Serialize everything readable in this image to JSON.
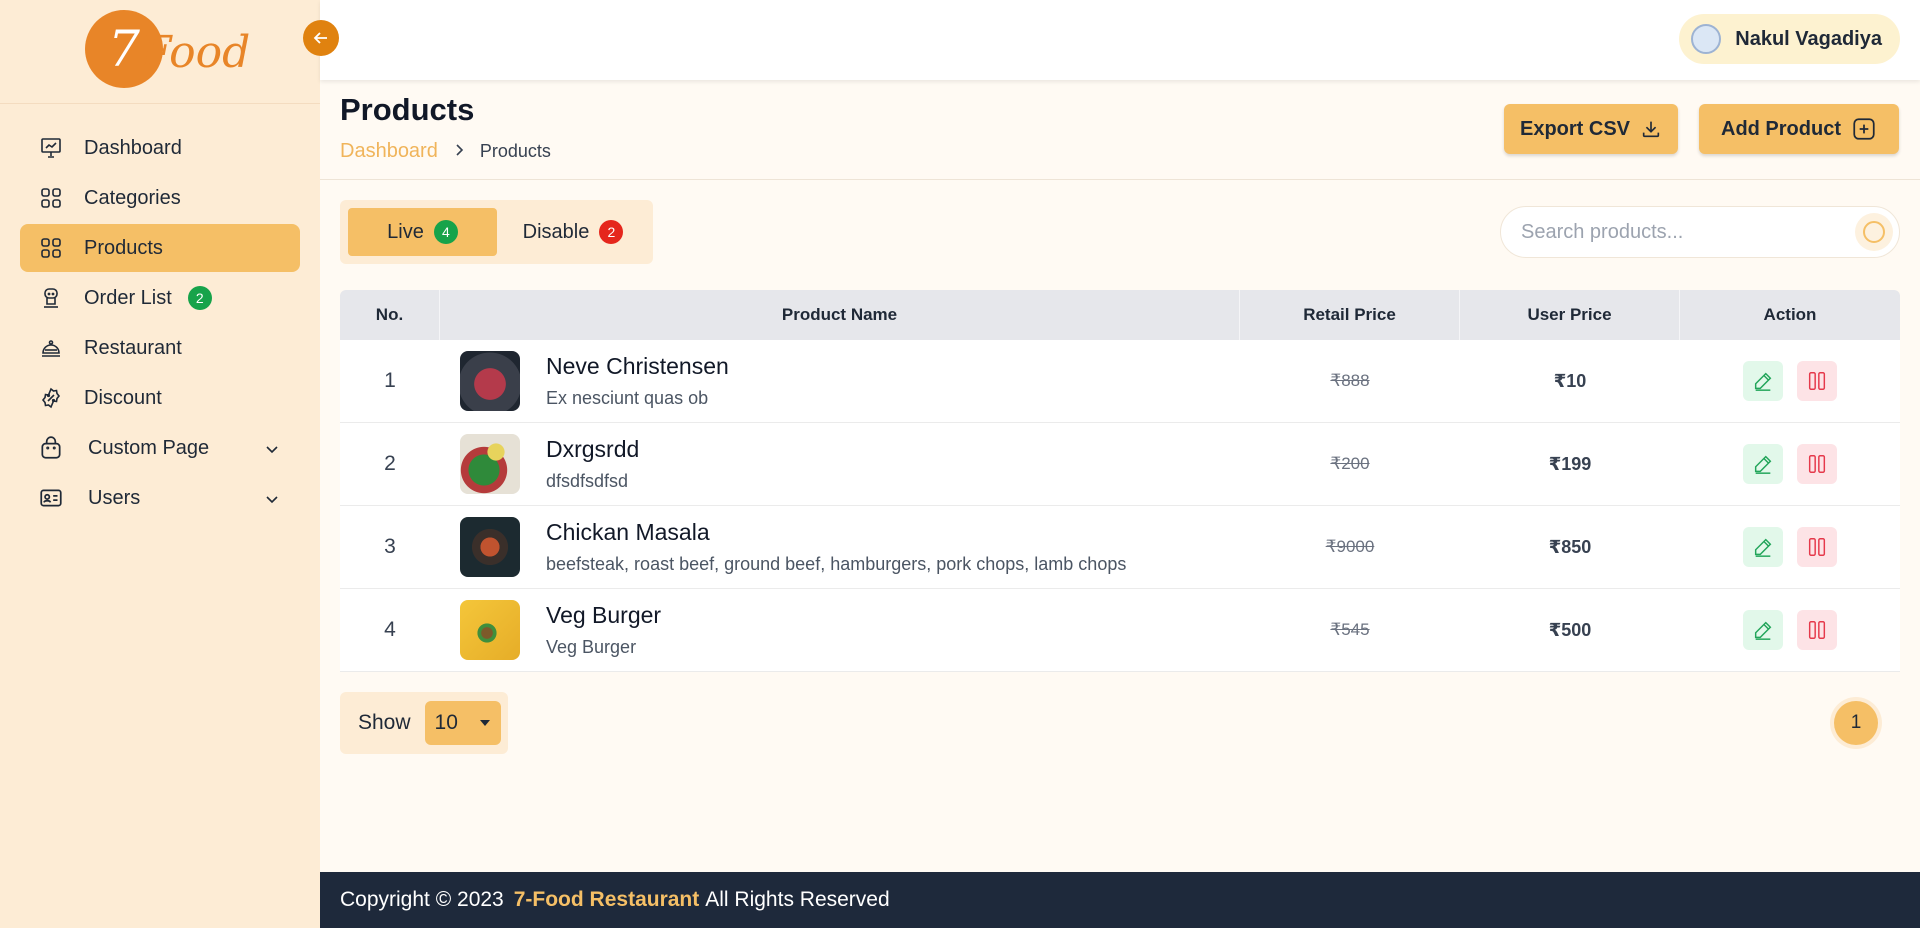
{
  "brand": {
    "logo_mark": "7",
    "logo_text": "Food"
  },
  "sidebar": {
    "items": [
      {
        "label": "Dashboard",
        "icon": "presentation-chart-icon"
      },
      {
        "label": "Categories",
        "icon": "grid-icon"
      },
      {
        "label": "Products",
        "icon": "grid-icon",
        "active": true
      },
      {
        "label": "Order List",
        "icon": "chef-icon",
        "badge": "2"
      },
      {
        "label": "Restaurant",
        "icon": "cloche-icon"
      },
      {
        "label": "Discount",
        "icon": "discount-badge-icon"
      },
      {
        "label": "Custom Page",
        "icon": "bag-icon"
      },
      {
        "label": "Users",
        "icon": "id-card-icon"
      }
    ]
  },
  "header": {
    "user_name": "Nakul Vagadiya"
  },
  "page": {
    "title": "Products",
    "breadcrumb": {
      "root": "Dashboard",
      "current": "Products"
    },
    "export_label": "Export CSV",
    "add_label": "Add Product"
  },
  "tabs": [
    {
      "label": "Live",
      "count": "4"
    },
    {
      "label": "Disable",
      "count": "2"
    }
  ],
  "search": {
    "placeholder": "Search products..."
  },
  "table": {
    "headers": [
      "No.",
      "Product Name",
      "Retail Price",
      "User Price",
      "Action"
    ],
    "rows": [
      {
        "no": "1",
        "name": "Neve Christensen",
        "desc": "Ex nesciunt quas ob",
        "retail": "₹888",
        "user": "₹10"
      },
      {
        "no": "2",
        "name": "Dxrgsrdd",
        "desc": "dfsdfsdfsd",
        "retail": "₹200",
        "user": "₹199"
      },
      {
        "no": "3",
        "name": "Chickan Masala",
        "desc": "beefsteak, roast beef, ground beef, hamburgers, pork chops, lamb chops",
        "retail": "₹9000",
        "user": "₹850"
      },
      {
        "no": "4",
        "name": "Veg Burger",
        "desc": "Veg Burger",
        "retail": "₹545",
        "user": "₹500"
      }
    ]
  },
  "pagination": {
    "show_label": "Show",
    "page_size": "10",
    "current_page": "1"
  },
  "footer": {
    "prefix": "Copyright © 2023",
    "brand": "7-Food Restaurant",
    "suffix": "All Rights Reserved"
  },
  "colors": {
    "accent": "#f5bf66",
    "sidebar_bg": "#fdecd5",
    "logo_orange": "#e88528",
    "footer_bg": "#1e293b",
    "success": "#17a34a",
    "danger": "#e5261c"
  }
}
